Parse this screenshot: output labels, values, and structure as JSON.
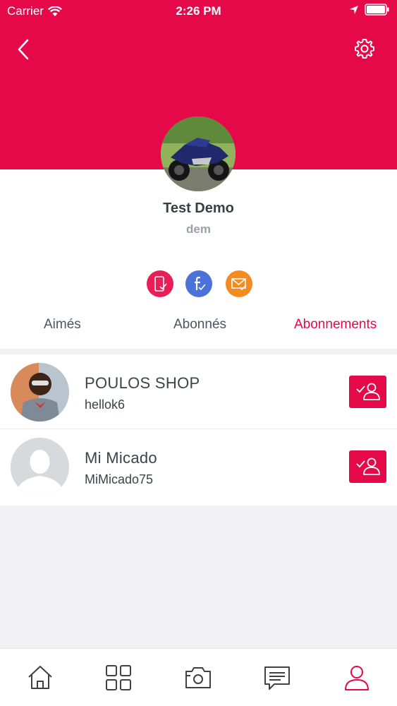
{
  "status_bar": {
    "carrier": "Carrier",
    "time": "2:26 PM"
  },
  "profile": {
    "name": "Test Demo",
    "username": "dem"
  },
  "verifications": [
    "phone-verified-icon",
    "facebook-verified-icon",
    "email-verified-icon"
  ],
  "tabs": [
    {
      "label": "Aimés",
      "active": false
    },
    {
      "label": "Abonnés",
      "active": false
    },
    {
      "label": "Abonnements",
      "active": true
    }
  ],
  "following": [
    {
      "name": "POULOS SHOP",
      "handle": "hellok6"
    },
    {
      "name": "Mi Micado",
      "handle": "MiMicado75"
    }
  ],
  "tabbar": [
    "home-icon",
    "grid-icon",
    "camera-icon",
    "messages-icon",
    "profile-icon"
  ],
  "colors": {
    "accent": "#e5094a",
    "phone": "#e91e57",
    "facebook": "#4a72d9",
    "email": "#f58a1f"
  }
}
